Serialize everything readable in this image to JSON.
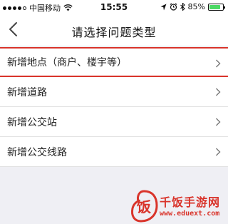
{
  "status_bar": {
    "carrier": "中国移动",
    "time": "15:55",
    "battery_percent": "85%",
    "battery_level": 0.85,
    "icons": [
      "signal-icon",
      "wifi-icon",
      "location-icon",
      "alarm-icon",
      "bluetooth-icon",
      "battery-icon"
    ]
  },
  "nav": {
    "title": "请选择问题类型",
    "back_icon": "chevron-left-icon"
  },
  "list": {
    "items": [
      {
        "label": "新增地点（商户、楼宇等）",
        "highlighted": true
      },
      {
        "label": "新增道路",
        "highlighted": false
      },
      {
        "label": "新增公交站",
        "highlighted": false
      },
      {
        "label": "新增公交线路",
        "highlighted": false
      }
    ],
    "chevron_icon": "chevron-right-icon"
  },
  "watermark": {
    "title": "千饭手游网",
    "url": "www.eduext.com",
    "badge_char": "饭"
  },
  "colors": {
    "accent_red": "#d9342b",
    "background": "#efeff4",
    "battery_green": "#4cd964"
  }
}
